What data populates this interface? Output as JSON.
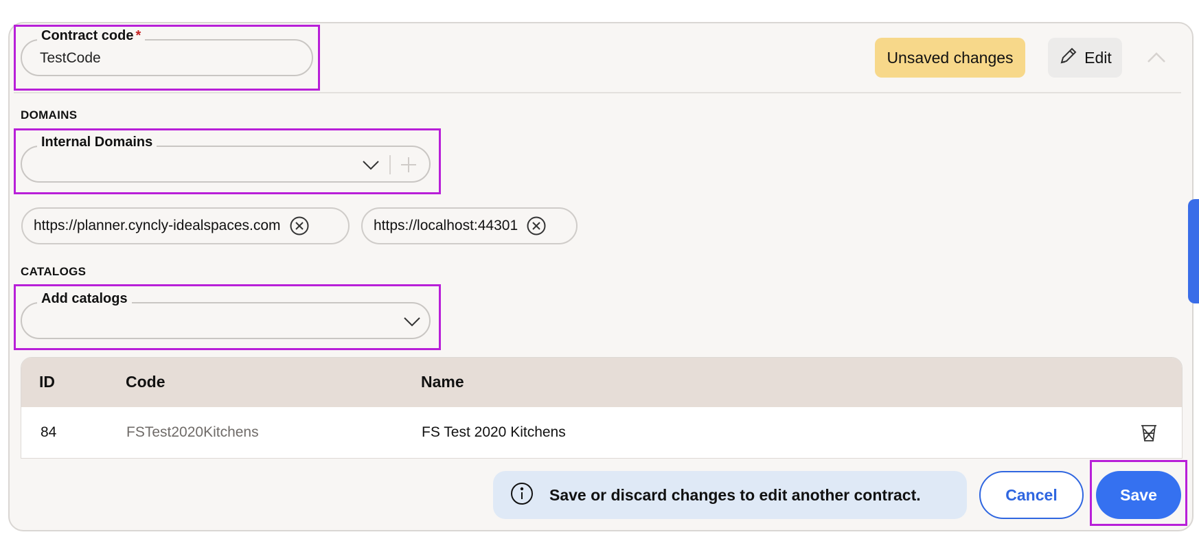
{
  "contract_code": {
    "label": "Contract code",
    "required_marker": "*",
    "value": "TestCode"
  },
  "header": {
    "unsaved_badge": "Unsaved changes",
    "edit_label": "Edit"
  },
  "domains": {
    "section_title": "DOMAINS",
    "field_label": "Internal Domains",
    "chips": [
      {
        "label": "https://planner.cyncly-idealspaces.com"
      },
      {
        "label": "https://localhost:44301"
      }
    ]
  },
  "catalogs": {
    "section_title": "CATALOGS",
    "field_label": "Add catalogs",
    "table": {
      "columns": [
        "ID",
        "Code",
        "Name"
      ],
      "rows": [
        {
          "id": "84",
          "code": "FSTest2020Kitchens",
          "name": "FS Test 2020 Kitchens"
        }
      ]
    }
  },
  "footer": {
    "info_text": "Save or discard changes to edit another contract.",
    "cancel_label": "Cancel",
    "save_label": "Save"
  },
  "colors": {
    "accent": "#3571f0",
    "highlight": "#b81fd8",
    "badge": "#f7d88a"
  }
}
